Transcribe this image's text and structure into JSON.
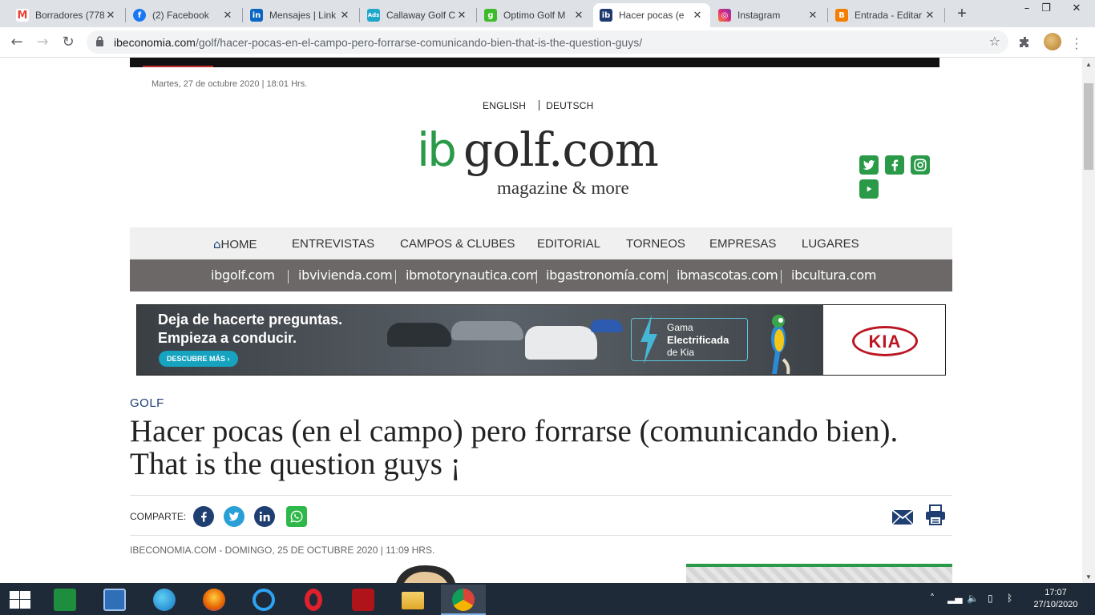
{
  "browser": {
    "tabs": [
      {
        "label": "Borradores (778",
        "icon": "gmail-icon",
        "color": "#ea4335"
      },
      {
        "label": "(2) Facebook",
        "icon": "facebook-icon",
        "color": "#1877f2"
      },
      {
        "label": "Mensajes | Link",
        "icon": "linkedin-icon",
        "color": "#0a66c2"
      },
      {
        "label": "Callaway Golf C",
        "icon": "google-ads-icon",
        "color": "#1fa7c9"
      },
      {
        "label": "Optimo Golf M",
        "icon": "g-icon",
        "color": "#3dbb2a"
      },
      {
        "label": "Hacer pocas (e",
        "icon": "ib-icon",
        "color": "#1e3a6e"
      },
      {
        "label": "Instagram",
        "icon": "instagram-icon",
        "color": "#d6249f"
      },
      {
        "label": "Entrada - Editar",
        "icon": "blogger-icon",
        "color": "#f57d00"
      }
    ],
    "active_tab": 5,
    "url_domain": "ibeconomia.com",
    "url_path": "/golf/hacer-pocas-en-el-campo-pero-forrarse-comunicando-bien-that-is-the-question-guys/"
  },
  "site": {
    "dateline": "Martes, 27 de octubre 2020 | 18:01 Hrs.",
    "lang_en": "ENGLISH",
    "lang_de": "DEUTSCH",
    "logo_ib": "ib",
    "logo_rest": "golf.com",
    "tagline": "magazine & more",
    "nav": [
      "HOME",
      "ENTREVISTAS",
      "CAMPOS & CLUBES",
      "EDITORIAL",
      "TORNEOS",
      "EMPRESAS",
      "LUGARES"
    ],
    "subnav": [
      "ibgolf.com",
      "ibvivienda.com",
      "ibmotorynautica.com",
      "ibgastronomía.com",
      "ibmascotas.com",
      "ibcultura.com"
    ]
  },
  "ad": {
    "headline_1": "Deja de hacerte preguntas.",
    "headline_2": "Empieza a conducir.",
    "cta": "DESCUBRE MÁS ›",
    "gama_1": "Gama",
    "gama_2": "Electrificada",
    "gama_3": "de Kia",
    "brand": "KIA"
  },
  "article": {
    "section": "GOLF",
    "title": "Hacer pocas (en el campo) pero forrarse (comunicando bien). That is the question guys ¡",
    "share_label": "COMPARTE:",
    "byline": "IBECONOMIA.COM - DOMINGO, 25 DE OCTUBRE 2020 | 11:09 HRS."
  },
  "taskbar": {
    "time": "17:07",
    "date": "27/10/2020"
  },
  "colors": {
    "brand_green": "#2a9a48",
    "nav_gray": "#6b6867",
    "section_blue": "#1f3f73"
  }
}
